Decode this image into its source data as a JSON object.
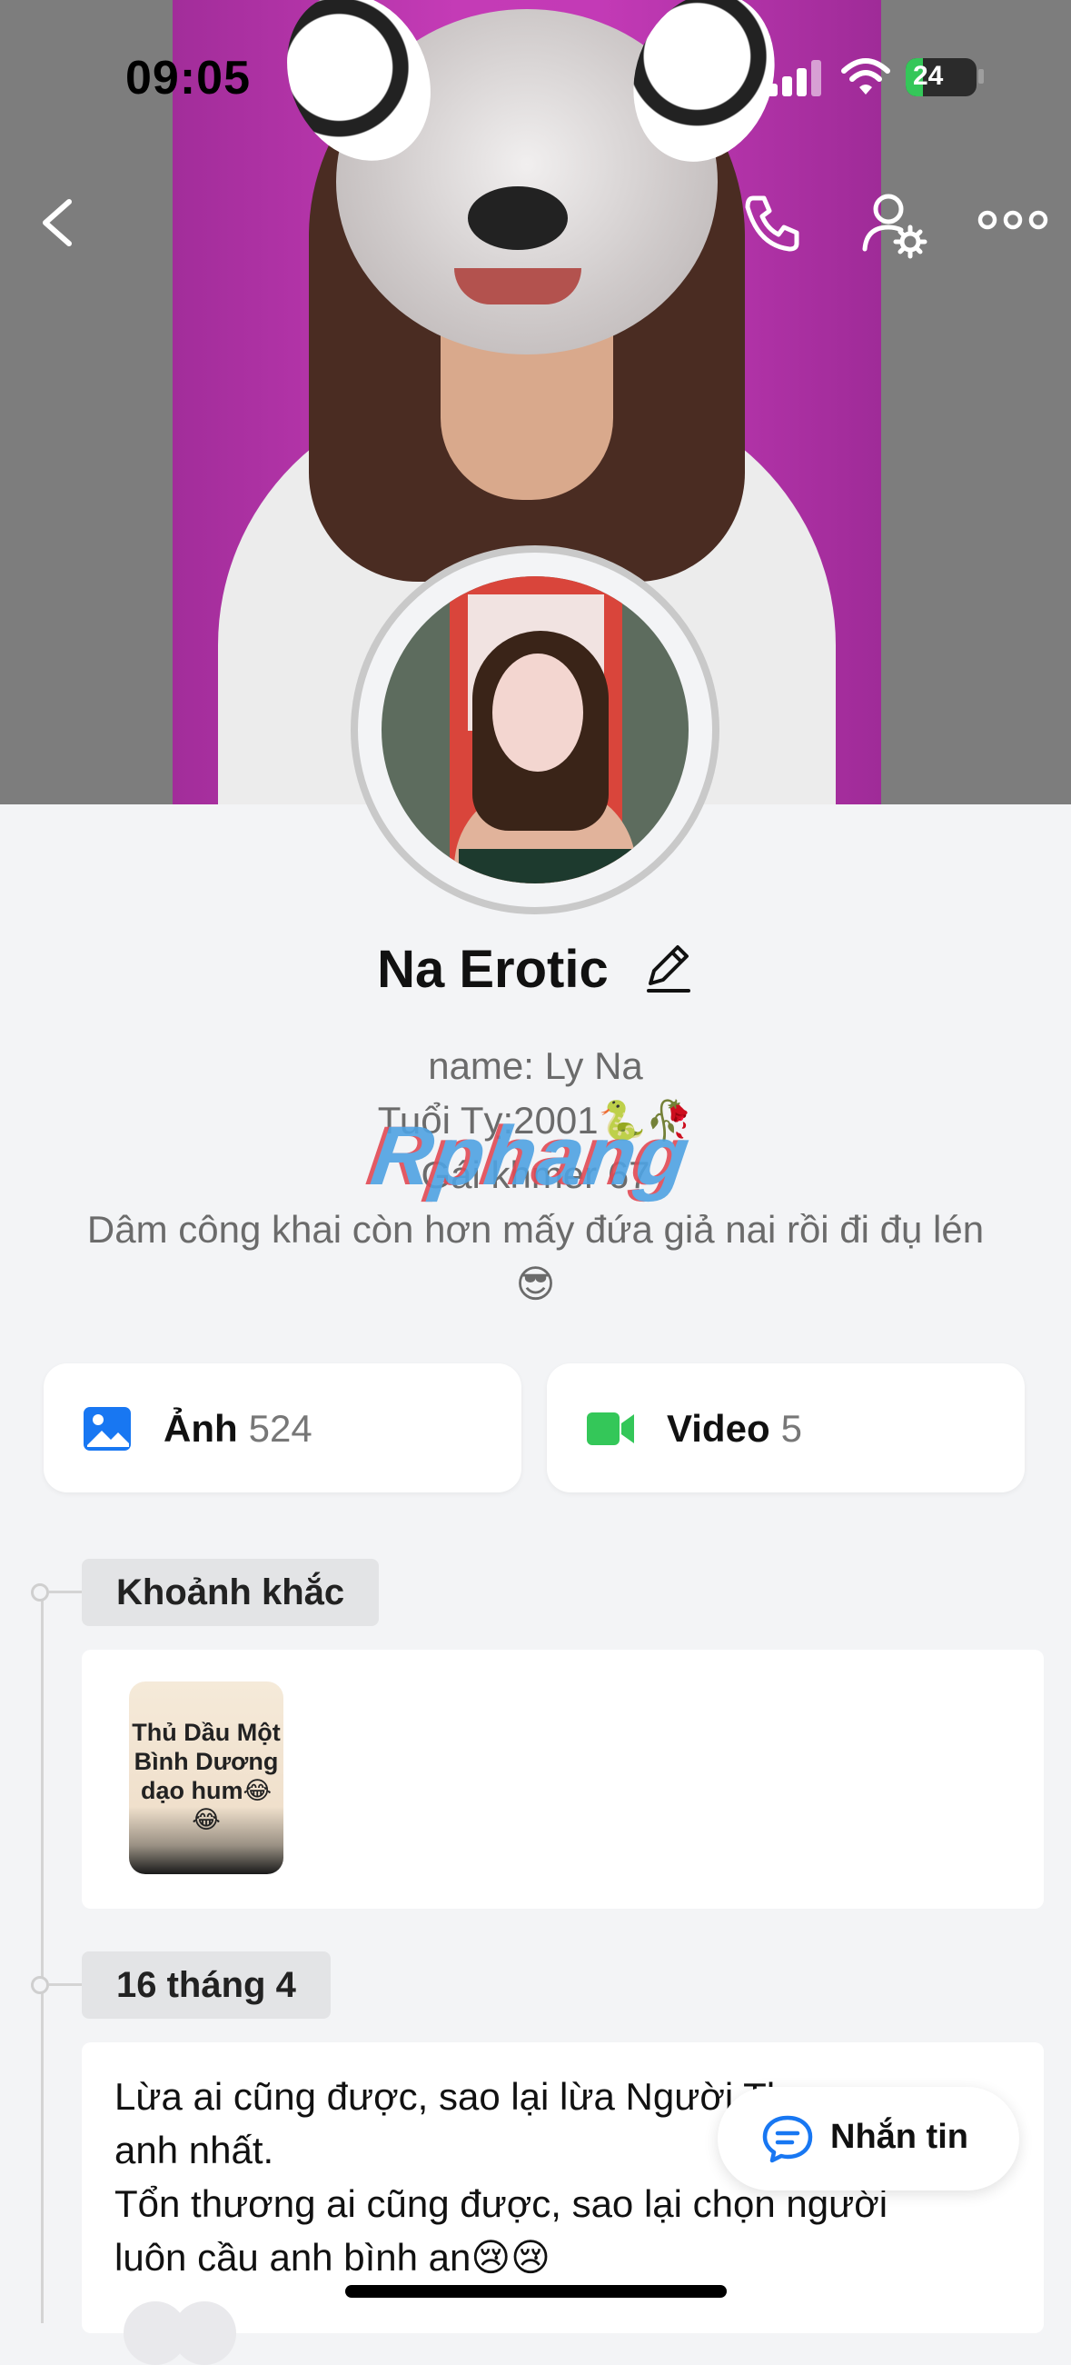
{
  "status_bar": {
    "time": "09:05",
    "battery": "24",
    "battery_level": 0.24
  },
  "nav": {
    "back_icon": "chevron-left-icon",
    "call_icon": "phone-icon",
    "settings_icon": "user-settings-icon",
    "more_icon": "more-dots-icon"
  },
  "profile": {
    "name": "Na Erotic",
    "edit_icon": "pencil-icon",
    "bio_lines": [
      "name: Ly Na",
      "Tuổi Tỵ:2001🐍🥀",
      "Gái khmer 67",
      "Dâm công khai còn hơn mấy đứa giả nai rồi đi đụ lén",
      "😎"
    ],
    "watermark": "Rphang"
  },
  "media": {
    "photos": {
      "label": "Ảnh",
      "count": "524",
      "icon": "image-icon",
      "color": "#1877f2"
    },
    "videos": {
      "label": "Video",
      "count": "5",
      "icon": "video-camera-icon",
      "color": "#34c759"
    }
  },
  "timeline": {
    "moments_label": "Khoảnh khắc",
    "moment_thumb_text": "Thủ Dầu Một Bình Dương dạo hum😂😂",
    "post_date": "16 tháng 4",
    "post_lines": [
      "Lừa ai cũng được, sao lại lừa Người Thương",
      "anh nhất.",
      "Tổn thương ai cũng được, sao lại chọn người",
      "luôn cầu anh bình an😢😢"
    ]
  },
  "message_button": {
    "label": "Nhắn tin",
    "icon": "chat-bubble-icon"
  }
}
